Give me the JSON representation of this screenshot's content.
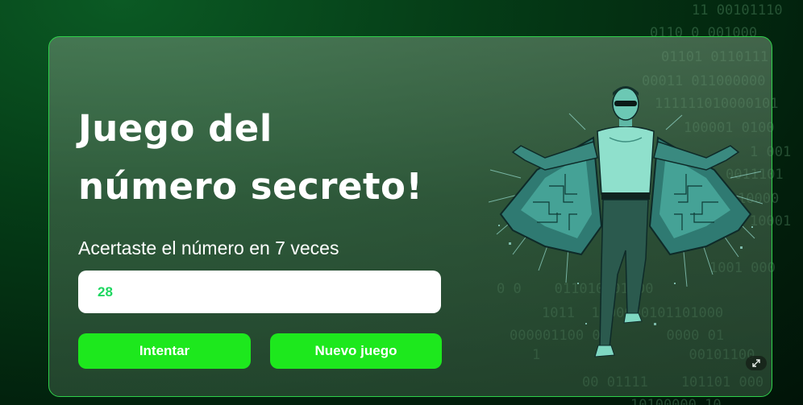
{
  "game": {
    "title_line1": "Juego del",
    "title_line2": "número secreto!",
    "message": "Acertaste el número en 7 veces",
    "input_value": "28",
    "try_button": "Intentar",
    "new_game_button": "Nuevo juego"
  },
  "colors": {
    "accent_green": "#1de81d",
    "input_text_green": "#1ed760",
    "card_border": "#2fd14a"
  },
  "icons": {
    "hero_image": "matrix-man-illustration",
    "expand": "expand-arrows-icon"
  }
}
